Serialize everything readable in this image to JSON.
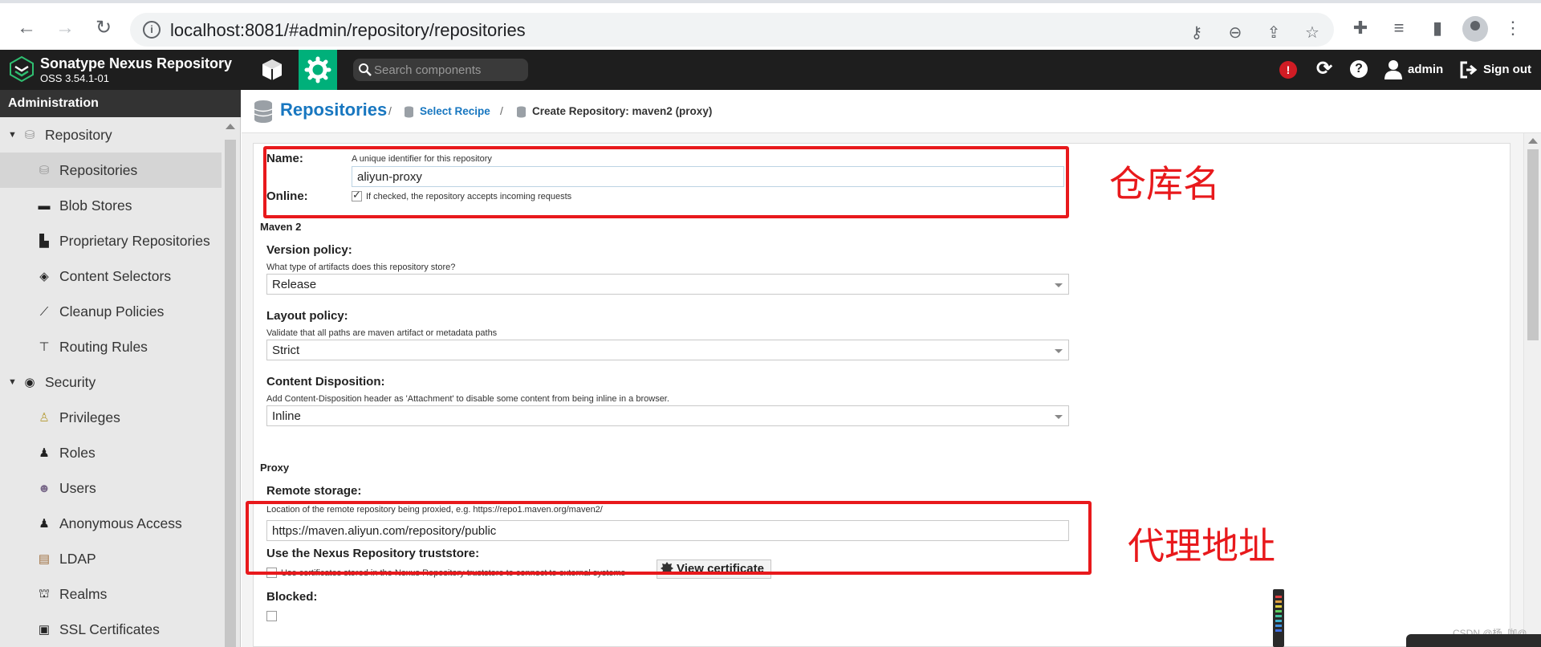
{
  "browser": {
    "url": "localhost:8081/#admin/repository/repositories"
  },
  "header": {
    "product_name": "Sonatype Nexus Repository",
    "version": "OSS 3.54.1-01",
    "search_placeholder": "Search components",
    "user_label": "admin",
    "signout_label": "Sign out",
    "alert_glyph": "!",
    "help_glyph": "?"
  },
  "sidebar": {
    "title": "Administration",
    "items": [
      {
        "label": "Repository",
        "icon": "database-icon",
        "type": "group"
      },
      {
        "label": "Repositories",
        "icon": "database-icon",
        "type": "child",
        "active": true
      },
      {
        "label": "Blob Stores",
        "icon": "hard-drive-icon",
        "type": "child"
      },
      {
        "label": "Proprietary Repositories",
        "icon": "door-icon",
        "type": "child"
      },
      {
        "label": "Content Selectors",
        "icon": "layers-icon",
        "type": "child"
      },
      {
        "label": "Cleanup Policies",
        "icon": "broom-icon",
        "type": "child"
      },
      {
        "label": "Routing Rules",
        "icon": "signpost-icon",
        "type": "child"
      },
      {
        "label": "Security",
        "icon": "eye-icon",
        "type": "group"
      },
      {
        "label": "Privileges",
        "icon": "medal-icon",
        "type": "child"
      },
      {
        "label": "Roles",
        "icon": "user-key-icon",
        "type": "child"
      },
      {
        "label": "Users",
        "icon": "users-icon",
        "type": "child"
      },
      {
        "label": "Anonymous Access",
        "icon": "user-icon",
        "type": "child"
      },
      {
        "label": "LDAP",
        "icon": "book-icon",
        "type": "child"
      },
      {
        "label": "Realms",
        "icon": "realms-icon",
        "type": "child"
      },
      {
        "label": "SSL Certificates",
        "icon": "certificate-icon",
        "type": "child"
      }
    ]
  },
  "breadcrumb": {
    "title": "Repositories",
    "sep": "/",
    "select_recipe": "Select Recipe",
    "current": "Create Repository: maven2 (proxy)"
  },
  "form": {
    "name_label": "Name:",
    "name_help": "A unique identifier for this repository",
    "name_value": "aliyun-proxy",
    "online_label": "Online:",
    "online_help": "If checked, the repository accepts incoming requests",
    "online_checked": true,
    "maven_section": "Maven 2",
    "version_policy_label": "Version policy:",
    "version_policy_help": "What type of artifacts does this repository store?",
    "version_policy_value": "Release",
    "layout_policy_label": "Layout policy:",
    "layout_policy_help": "Validate that all paths are maven artifact or metadata paths",
    "layout_policy_value": "Strict",
    "content_disposition_label": "Content Disposition:",
    "content_disposition_help": "Add Content-Disposition header as 'Attachment' to disable some content from being inline in a browser.",
    "content_disposition_value": "Inline",
    "proxy_section": "Proxy",
    "remote_storage_label": "Remote storage:",
    "remote_storage_help": "Location of the remote repository being proxied, e.g. https://repo1.maven.org/maven2/",
    "remote_storage_value": "https://maven.aliyun.com/repository/public",
    "truststore_label": "Use the Nexus Repository truststore:",
    "truststore_help": "Use certificates stored in the Nexus Repository truststore to connect to external systems",
    "view_certificate": "View certificate",
    "blocked_label": "Blocked:"
  },
  "annotations": {
    "repo_name": "仓库名",
    "proxy_address": "代理地址"
  },
  "watermark": "CSDN @杨_咖@",
  "colors": {
    "accent": "#1877c0",
    "admin_green": "#00b07a",
    "header_dark": "#1e1e1e",
    "annotation_red": "#e8191c",
    "alert_red": "#d01c24"
  }
}
